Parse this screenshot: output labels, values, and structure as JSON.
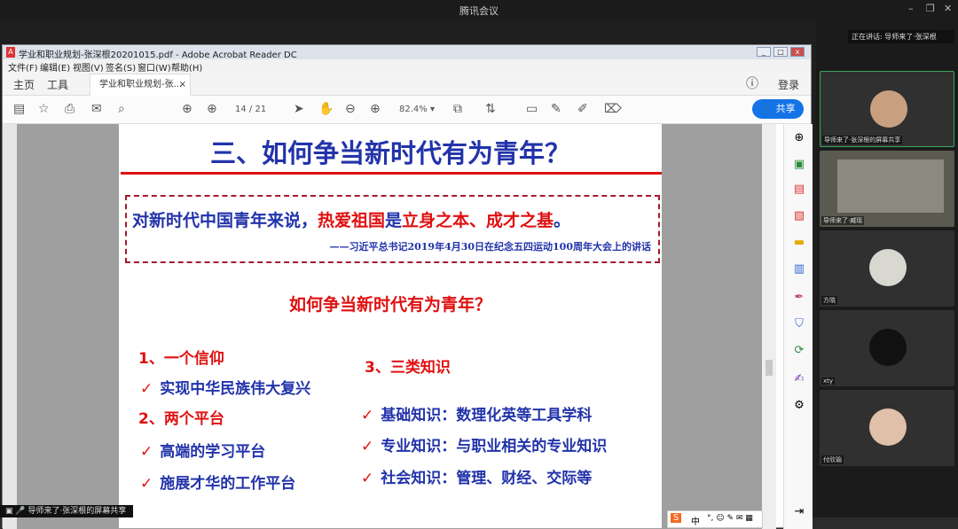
{
  "meeting": {
    "title": "腾讯会议",
    "speaking": "正在讲话: 导师来了·张深根",
    "bottom_label": "导师来了·张深根的屏幕共享"
  },
  "acrobat": {
    "window_title": "学业和职业规划-张深根20201015.pdf - Adobe Acrobat Reader DC",
    "menus": [
      "文件(F)",
      "编辑(E)",
      "视图(V)",
      "签名(S)",
      "窗口(W)",
      "帮助(H)"
    ],
    "nav": {
      "home": "主页",
      "tools": "工具",
      "tab": "学业和职业规划-张...",
      "login": "登录"
    },
    "page_current": "14",
    "page_total": "/ 21",
    "zoom": "82.4%",
    "share": "共享"
  },
  "slide": {
    "title": "三、如何争当新时代有为青年？",
    "quote_a": "对新时代中国青年来说，",
    "quote_b": "热爱祖国",
    "quote_c": "是",
    "quote_d": "立身之本、成才之基",
    "quote_e": "。",
    "quote_source": "——习近平总书记2019年4月30日在纪念五四运动100周年大会上的讲话",
    "subtitle": "如何争当新时代有为青年？",
    "h1": "1、一个信仰",
    "i1": "实现中华民族伟大复兴",
    "h2": "2、两个平台",
    "i2": "高端的学习平台",
    "i3": "施展才华的工作平台",
    "h3": "3、三类知识",
    "i4": "基础知识：数理化英等工具学科",
    "i5": "专业知识：与职业相关的专业知识",
    "i6": "社会知识：管理、财经、交际等"
  },
  "ime": {
    "label": "中"
  },
  "participants": [
    {
      "name": "导师来了·张深根的屏幕共享"
    },
    {
      "name": "导师来了·臧瑶"
    },
    {
      "name": "方晓"
    },
    {
      "name": "xty"
    },
    {
      "name": "付欣瑜"
    }
  ]
}
